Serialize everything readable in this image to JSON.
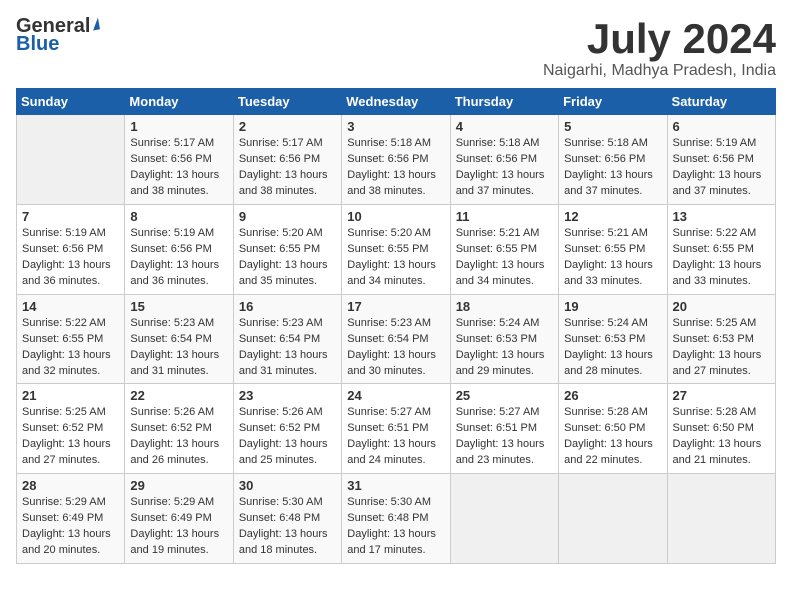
{
  "header": {
    "logo_general": "General",
    "logo_blue": "Blue",
    "month_title": "July 2024",
    "location": "Naigarhi, Madhya Pradesh, India"
  },
  "weekdays": [
    "Sunday",
    "Monday",
    "Tuesday",
    "Wednesday",
    "Thursday",
    "Friday",
    "Saturday"
  ],
  "weeks": [
    [
      {
        "day": "",
        "sunrise": "",
        "sunset": "",
        "daylight": ""
      },
      {
        "day": "1",
        "sunrise": "Sunrise: 5:17 AM",
        "sunset": "Sunset: 6:56 PM",
        "daylight": "Daylight: 13 hours and 38 minutes."
      },
      {
        "day": "2",
        "sunrise": "Sunrise: 5:17 AM",
        "sunset": "Sunset: 6:56 PM",
        "daylight": "Daylight: 13 hours and 38 minutes."
      },
      {
        "day": "3",
        "sunrise": "Sunrise: 5:18 AM",
        "sunset": "Sunset: 6:56 PM",
        "daylight": "Daylight: 13 hours and 38 minutes."
      },
      {
        "day": "4",
        "sunrise": "Sunrise: 5:18 AM",
        "sunset": "Sunset: 6:56 PM",
        "daylight": "Daylight: 13 hours and 37 minutes."
      },
      {
        "day": "5",
        "sunrise": "Sunrise: 5:18 AM",
        "sunset": "Sunset: 6:56 PM",
        "daylight": "Daylight: 13 hours and 37 minutes."
      },
      {
        "day": "6",
        "sunrise": "Sunrise: 5:19 AM",
        "sunset": "Sunset: 6:56 PM",
        "daylight": "Daylight: 13 hours and 37 minutes."
      }
    ],
    [
      {
        "day": "7",
        "sunrise": "Sunrise: 5:19 AM",
        "sunset": "Sunset: 6:56 PM",
        "daylight": "Daylight: 13 hours and 36 minutes."
      },
      {
        "day": "8",
        "sunrise": "Sunrise: 5:19 AM",
        "sunset": "Sunset: 6:56 PM",
        "daylight": "Daylight: 13 hours and 36 minutes."
      },
      {
        "day": "9",
        "sunrise": "Sunrise: 5:20 AM",
        "sunset": "Sunset: 6:55 PM",
        "daylight": "Daylight: 13 hours and 35 minutes."
      },
      {
        "day": "10",
        "sunrise": "Sunrise: 5:20 AM",
        "sunset": "Sunset: 6:55 PM",
        "daylight": "Daylight: 13 hours and 34 minutes."
      },
      {
        "day": "11",
        "sunrise": "Sunrise: 5:21 AM",
        "sunset": "Sunset: 6:55 PM",
        "daylight": "Daylight: 13 hours and 34 minutes."
      },
      {
        "day": "12",
        "sunrise": "Sunrise: 5:21 AM",
        "sunset": "Sunset: 6:55 PM",
        "daylight": "Daylight: 13 hours and 33 minutes."
      },
      {
        "day": "13",
        "sunrise": "Sunrise: 5:22 AM",
        "sunset": "Sunset: 6:55 PM",
        "daylight": "Daylight: 13 hours and 33 minutes."
      }
    ],
    [
      {
        "day": "14",
        "sunrise": "Sunrise: 5:22 AM",
        "sunset": "Sunset: 6:55 PM",
        "daylight": "Daylight: 13 hours and 32 minutes."
      },
      {
        "day": "15",
        "sunrise": "Sunrise: 5:23 AM",
        "sunset": "Sunset: 6:54 PM",
        "daylight": "Daylight: 13 hours and 31 minutes."
      },
      {
        "day": "16",
        "sunrise": "Sunrise: 5:23 AM",
        "sunset": "Sunset: 6:54 PM",
        "daylight": "Daylight: 13 hours and 31 minutes."
      },
      {
        "day": "17",
        "sunrise": "Sunrise: 5:23 AM",
        "sunset": "Sunset: 6:54 PM",
        "daylight": "Daylight: 13 hours and 30 minutes."
      },
      {
        "day": "18",
        "sunrise": "Sunrise: 5:24 AM",
        "sunset": "Sunset: 6:53 PM",
        "daylight": "Daylight: 13 hours and 29 minutes."
      },
      {
        "day": "19",
        "sunrise": "Sunrise: 5:24 AM",
        "sunset": "Sunset: 6:53 PM",
        "daylight": "Daylight: 13 hours and 28 minutes."
      },
      {
        "day": "20",
        "sunrise": "Sunrise: 5:25 AM",
        "sunset": "Sunset: 6:53 PM",
        "daylight": "Daylight: 13 hours and 27 minutes."
      }
    ],
    [
      {
        "day": "21",
        "sunrise": "Sunrise: 5:25 AM",
        "sunset": "Sunset: 6:52 PM",
        "daylight": "Daylight: 13 hours and 27 minutes."
      },
      {
        "day": "22",
        "sunrise": "Sunrise: 5:26 AM",
        "sunset": "Sunset: 6:52 PM",
        "daylight": "Daylight: 13 hours and 26 minutes."
      },
      {
        "day": "23",
        "sunrise": "Sunrise: 5:26 AM",
        "sunset": "Sunset: 6:52 PM",
        "daylight": "Daylight: 13 hours and 25 minutes."
      },
      {
        "day": "24",
        "sunrise": "Sunrise: 5:27 AM",
        "sunset": "Sunset: 6:51 PM",
        "daylight": "Daylight: 13 hours and 24 minutes."
      },
      {
        "day": "25",
        "sunrise": "Sunrise: 5:27 AM",
        "sunset": "Sunset: 6:51 PM",
        "daylight": "Daylight: 13 hours and 23 minutes."
      },
      {
        "day": "26",
        "sunrise": "Sunrise: 5:28 AM",
        "sunset": "Sunset: 6:50 PM",
        "daylight": "Daylight: 13 hours and 22 minutes."
      },
      {
        "day": "27",
        "sunrise": "Sunrise: 5:28 AM",
        "sunset": "Sunset: 6:50 PM",
        "daylight": "Daylight: 13 hours and 21 minutes."
      }
    ],
    [
      {
        "day": "28",
        "sunrise": "Sunrise: 5:29 AM",
        "sunset": "Sunset: 6:49 PM",
        "daylight": "Daylight: 13 hours and 20 minutes."
      },
      {
        "day": "29",
        "sunrise": "Sunrise: 5:29 AM",
        "sunset": "Sunset: 6:49 PM",
        "daylight": "Daylight: 13 hours and 19 minutes."
      },
      {
        "day": "30",
        "sunrise": "Sunrise: 5:30 AM",
        "sunset": "Sunset: 6:48 PM",
        "daylight": "Daylight: 13 hours and 18 minutes."
      },
      {
        "day": "31",
        "sunrise": "Sunrise: 5:30 AM",
        "sunset": "Sunset: 6:48 PM",
        "daylight": "Daylight: 13 hours and 17 minutes."
      },
      {
        "day": "",
        "sunrise": "",
        "sunset": "",
        "daylight": ""
      },
      {
        "day": "",
        "sunrise": "",
        "sunset": "",
        "daylight": ""
      },
      {
        "day": "",
        "sunrise": "",
        "sunset": "",
        "daylight": ""
      }
    ]
  ]
}
